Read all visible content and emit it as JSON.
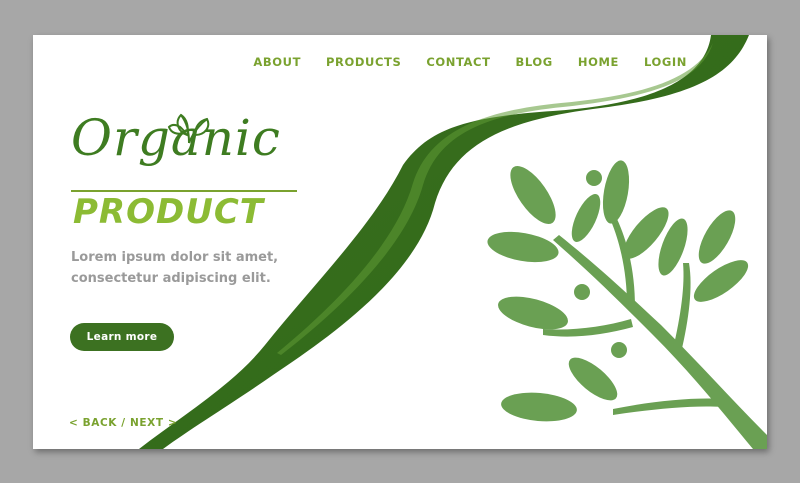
{
  "nav": {
    "items": [
      {
        "label": "ABOUT"
      },
      {
        "label": "PRODUCTS"
      },
      {
        "label": "CONTACT"
      },
      {
        "label": "BLOG"
      },
      {
        "label": "HOME"
      },
      {
        "label": "LOGIN"
      }
    ]
  },
  "hero": {
    "logo_script": "Organic",
    "logo_product": "PRODUCT",
    "tagline_line1": "Lorem ipsum dolor sit amet,",
    "tagline_line2": "consectetur adipiscing elit.",
    "cta_label": "Learn more"
  },
  "pager": {
    "back_label": "< BACK",
    "separator": "/",
    "next_label": "NEXT >"
  },
  "colors": {
    "dark_green": "#3c7121",
    "mid_green": "#4f8a2a",
    "light_green": "#8cbb34",
    "nav_green": "#7aa22f",
    "leaf_green": "#6aa053",
    "frame_gray": "#a7a7a7"
  },
  "icons": [
    "leaf-sprig-icon",
    "plant-branch-illustration"
  ]
}
